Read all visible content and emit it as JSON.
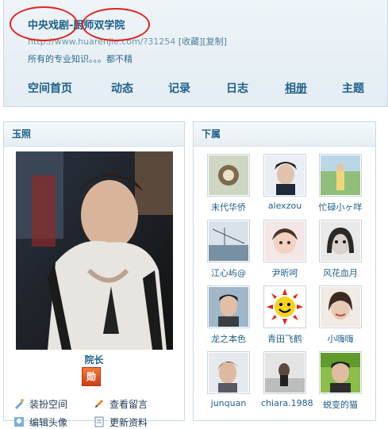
{
  "header": {
    "title_part1": "中央戏剧",
    "title_sep": "-",
    "title_part2": "厨师双学院",
    "url": "http://www.huarenjie.com/?31254",
    "bookmark": "[收藏]",
    "copy": "[复制]",
    "description": "所有的专业知识。。。都不精"
  },
  "nav": [
    "空间首页",
    "动态",
    "记录",
    "日志",
    "相册",
    "主题"
  ],
  "left_panel": {
    "title": "玉照",
    "role": "院长",
    "badge": "勋",
    "actions": [
      "装扮空间",
      "查看留言",
      "编辑头像",
      "更新资料"
    ]
  },
  "right_panel": {
    "title": "下属",
    "friends": [
      "末代华侨",
      "alexzou",
      "忙碌小ヶ咩",
      "江心屿@",
      "尹昕呵",
      "风花血月",
      "龙之本色",
      "青田飞鹤",
      "小嗨嗨",
      "junquan",
      "chiara.1988",
      "蜕变的猫"
    ]
  },
  "annotations": {
    "color": "#e0261c"
  }
}
